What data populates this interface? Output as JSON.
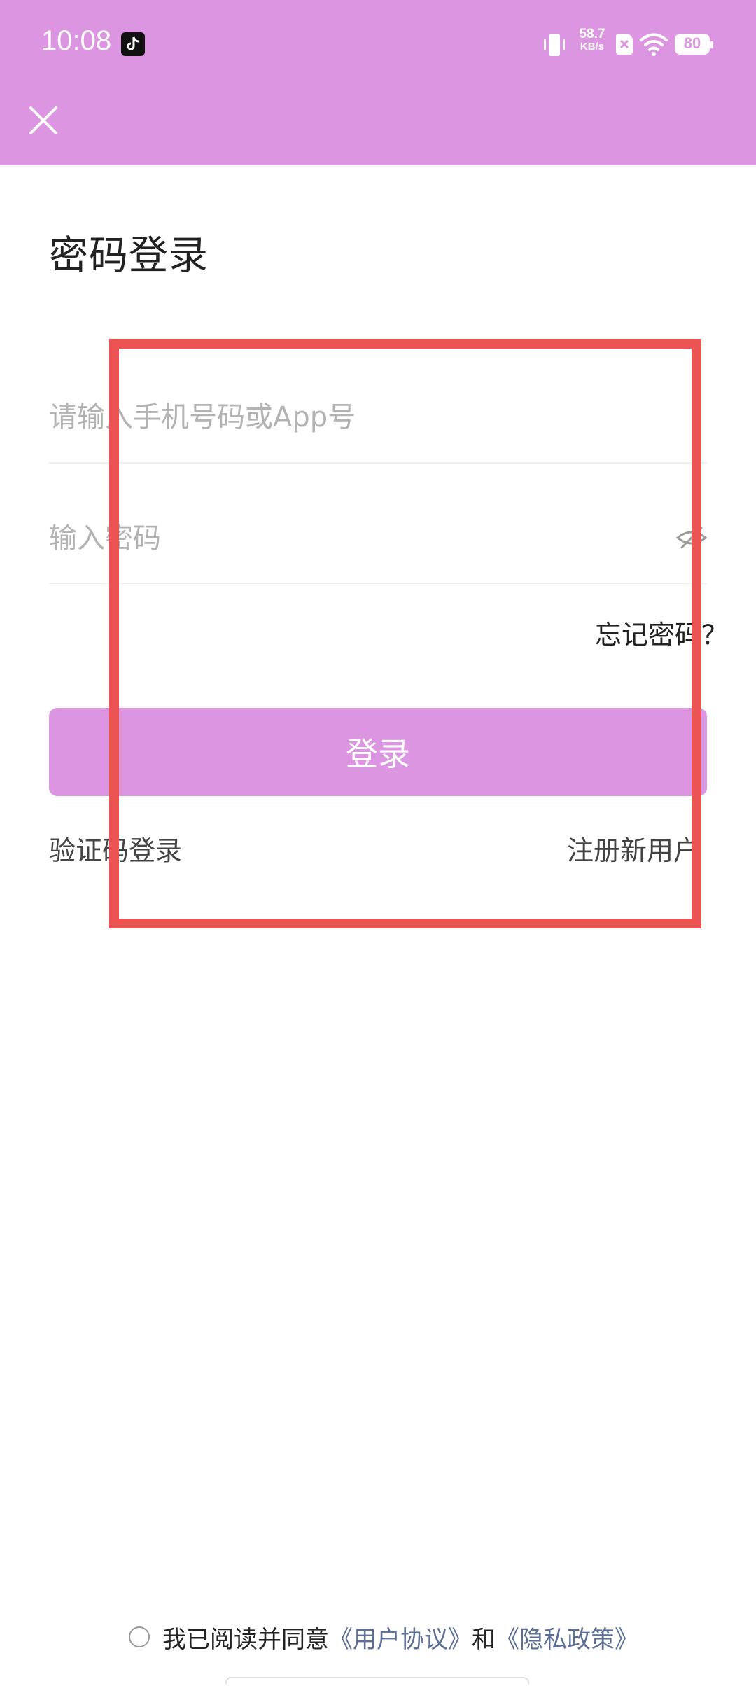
{
  "status_bar": {
    "time": "10:08",
    "net_speed_value": "58.7",
    "net_speed_unit": "KB/s",
    "battery_level": "80",
    "icons": [
      "tiktok-icon",
      "vibrate-icon",
      "sim-icon",
      "wifi-icon",
      "battery-icon"
    ]
  },
  "header": {
    "close_icon": "close-icon"
  },
  "title": "密码登录",
  "form": {
    "phone_placeholder": "请输入手机号码或App号",
    "password_placeholder": "输入密码",
    "forgot_password": "忘记密码？",
    "login_button": "登录",
    "code_login": "验证码登录",
    "register": "注册新用户"
  },
  "agreement": {
    "prefix": "我已阅读并同意",
    "user_agreement": "《用户协议》",
    "and": "和",
    "privacy_policy": "《隐私政策》"
  },
  "colors": {
    "accent": "#dc95e0",
    "highlight_border": "#ec5353",
    "link": "#5a6e96"
  }
}
